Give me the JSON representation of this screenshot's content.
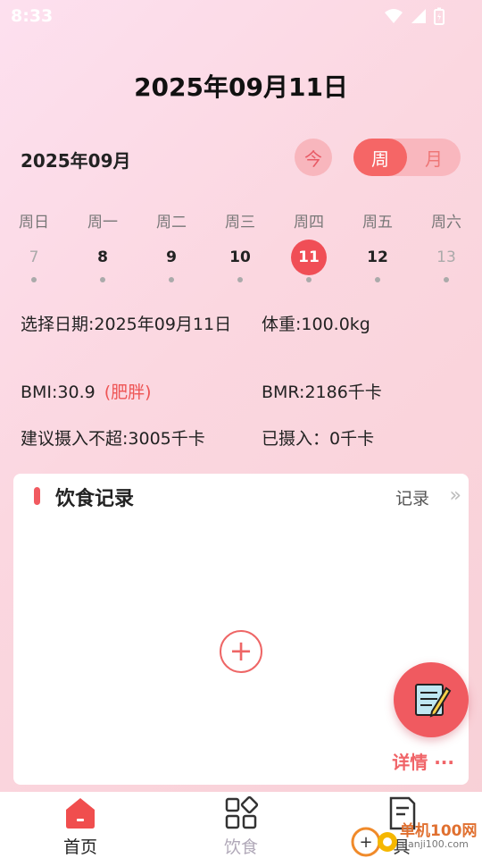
{
  "status_bar": {
    "time": "8:33"
  },
  "header": {
    "title": "2025年09月11日"
  },
  "calendar": {
    "month": "2025年09月",
    "today_label": "今",
    "view_toggle": {
      "week": "周",
      "month": "月"
    },
    "weekdays": [
      "周日",
      "周一",
      "周二",
      "周三",
      "周四",
      "周五",
      "周六"
    ],
    "days": [
      "7",
      "8",
      "9",
      "10",
      "11",
      "12",
      "13"
    ],
    "selected_day": "11"
  },
  "info": {
    "selected_date": "选择日期:2025年09月11日",
    "weight": "体重:100.0kg",
    "bmi": "BMI:30.9",
    "bmi_note": "(肥胖)",
    "bmr": "BMR:2186千卡",
    "suggested_intake": "建议摄入不超:3005千卡",
    "consumed": "已摄入：0千卡"
  },
  "diet_card": {
    "title": "饮食记录",
    "record_label": "记录",
    "detail_label": "详情 ···"
  },
  "tabs": [
    {
      "label": "首页",
      "icon": "home-icon"
    },
    {
      "label": "饮食",
      "icon": "grid-icon"
    },
    {
      "label": "具",
      "icon": "document-icon"
    }
  ],
  "watermark": {
    "line1": "单机100网",
    "line2": "danji100.com"
  },
  "colors": {
    "accent": "#f04e56",
    "accent_light": "#f9b7be"
  }
}
